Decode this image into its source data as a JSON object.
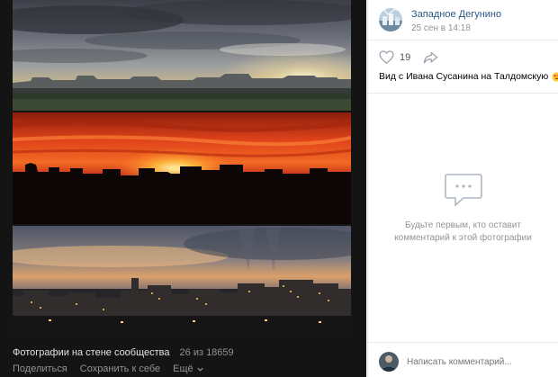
{
  "viewer": {
    "album_title": "Фотографии на стене сообщества",
    "counter": "26 из 18659",
    "share_label": "Поделиться",
    "save_label": "Сохранить к себе",
    "more_label": "Ещё"
  },
  "post": {
    "author_name": "Западное Дегунино",
    "time": "25 сен в 14:18",
    "likes": "19",
    "caption": "Вид с Ивана Сусанина на Талдомскую"
  },
  "comments": {
    "empty_line1": "Будьте первым, кто оставит",
    "empty_line2": "комментарий к этой фотографии",
    "input_placeholder": "Написать комментарий..."
  },
  "colors": {
    "link": "#2a5885",
    "muted": "#939393",
    "viewer_bg": "#141414"
  },
  "icons": [
    "heart-icon",
    "share-arrow-icon",
    "heart-eyes-emoji",
    "comment-bubble-icon",
    "chevron-down-icon"
  ]
}
